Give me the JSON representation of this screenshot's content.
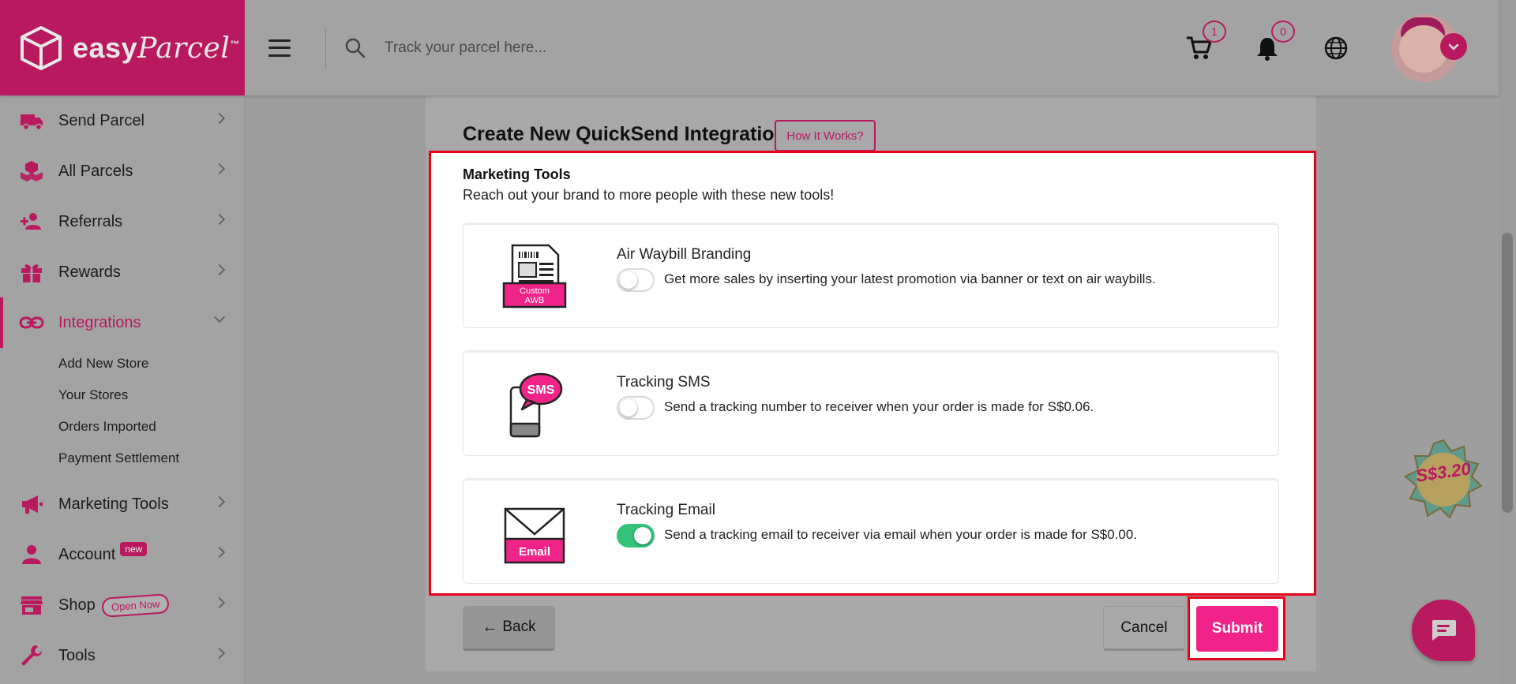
{
  "brand": {
    "name": "easy",
    "name2": "Parcel",
    "tm": "™"
  },
  "header": {
    "search_placeholder": "Track your parcel here...",
    "cart_count": "1",
    "notif_count": "0"
  },
  "sidebar": {
    "items": [
      {
        "label": "Send Parcel"
      },
      {
        "label": "All Parcels"
      },
      {
        "label": "Referrals"
      },
      {
        "label": "Rewards"
      },
      {
        "label": "Integrations"
      },
      {
        "label": "Marketing Tools"
      },
      {
        "label": "Account",
        "badge": "new"
      },
      {
        "label": "Shop",
        "badge": "Open Now"
      },
      {
        "label": "Tools"
      }
    ],
    "sub_items": [
      {
        "label": "Add New Store"
      },
      {
        "label": "Your Stores"
      },
      {
        "label": "Orders Imported"
      },
      {
        "label": "Payment Settlement"
      }
    ]
  },
  "main": {
    "title": "Create New QuickSend Integration",
    "how_it_works": "How It Works?",
    "section_title": "Marketing Tools",
    "section_subtitle": "Reach out your brand to more people with these new tools!",
    "tools": [
      {
        "name": "Air Waybill Branding",
        "desc": "Get more sales by inserting your latest promotion via banner or text on air waybills.",
        "enabled": false,
        "icon_text_1": "Custom",
        "icon_text_2": "AWB"
      },
      {
        "name": "Tracking SMS",
        "desc": "Send a tracking number to receiver when your order is made for S$0.06.",
        "enabled": false,
        "icon_text_1": "SMS"
      },
      {
        "name": "Tracking Email",
        "desc": "Send a tracking email to receiver via email when your order is made for S$0.00.",
        "enabled": true,
        "icon_text_1": "Email"
      }
    ],
    "back_label": "Back",
    "back_arrow": "←",
    "cancel_label": "Cancel",
    "submit_label": "Submit"
  },
  "promo": {
    "price": "S$3.20"
  },
  "colors": {
    "brand": "#b8195f",
    "submit": "#f02488",
    "toggle_on": "#35c37a",
    "highlight": "#e8001b"
  }
}
